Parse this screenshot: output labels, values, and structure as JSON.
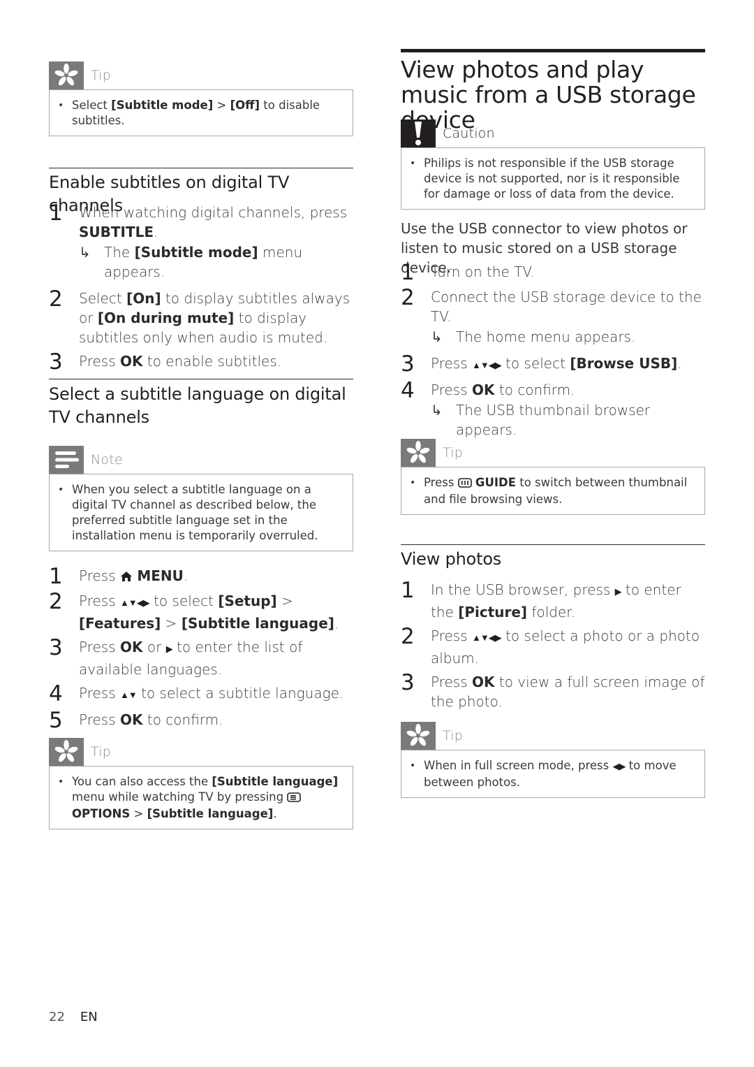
{
  "page": {
    "number": "22",
    "language": "EN"
  },
  "left": {
    "tip1": {
      "title": "Tip",
      "icon": "asterisk-tip-icon",
      "text_pre": "Select ",
      "bold1": "[Subtitle mode]",
      "mid": " > ",
      "bold2": "[Off]",
      "text_post": " to disable subtitles."
    },
    "section_enable": {
      "heading": "Enable subtitles on digital TV channels",
      "steps": [
        {
          "num": "1",
          "pre": "When watching digital channels, press ",
          "bold": "SUBTITLE",
          "post": ".",
          "result_pre": "The ",
          "result_bold": "[Subtitle mode]",
          "result_post": " menu appears."
        },
        {
          "num": "2",
          "pre": "Select ",
          "bold1": "[On]",
          "mid": " to display subtitles always or ",
          "bold2": "[On during mute]",
          "post": " to display subtitles only when audio is muted."
        },
        {
          "num": "3",
          "pre": "Press ",
          "bold": "OK",
          "post": " to enable subtitles."
        }
      ]
    },
    "section_language": {
      "heading": "Select a subtitle language on digital TV channels",
      "note": {
        "title": "Note",
        "icon": "note-lines-icon",
        "text": "When you select a subtitle language on a digital TV channel as described below, the preferred subtitle language set in the installation menu is temporarily overruled."
      },
      "steps": [
        {
          "num": "1",
          "pre": "Press ",
          "icon": "home-icon",
          "bold": "MENU",
          "post": "."
        },
        {
          "num": "2",
          "pre": "Press ",
          "nav": "▲▼◀▶",
          "mid": " to select ",
          "bold1": "[Setup]",
          "sep1": " > ",
          "bold2": "[Features]",
          "sep2": " > ",
          "bold3": "[Subtitle language]",
          "post": "."
        },
        {
          "num": "3",
          "pre": "Press ",
          "bold": "OK",
          "mid": " or ",
          "nav": "▶",
          "post": " to enter the list of available languages."
        },
        {
          "num": "4",
          "pre": "Press ",
          "nav": "▲▼",
          "post": " to select a subtitle language."
        },
        {
          "num": "5",
          "pre": "Press ",
          "bold": "OK",
          "post": " to confirm."
        }
      ],
      "tip": {
        "title": "Tip",
        "icon": "asterisk-tip-icon",
        "pre": "You can also access the ",
        "bold1": "[Subtitle language]",
        "mid": " menu while watching TV by pressing ",
        "options_icon": "options-icon",
        "bold2": "OPTIONS",
        "sep": " > ",
        "bold3": "[Subtitle language]",
        "post": "."
      }
    }
  },
  "right": {
    "title": "View photos and play music from a USB storage device",
    "caution": {
      "title": "Caution",
      "icon": "exclamation-caution-icon",
      "text": "Philips is not responsible if the USB storage device is not supported, nor is it responsible for damage or loss of data from the device."
    },
    "intro": "Use the USB connector to view photos or listen to music stored on a USB storage device.",
    "steps": [
      {
        "num": "1",
        "text": "Turn on the TV."
      },
      {
        "num": "2",
        "text": "Connect the USB storage device to the TV.",
        "result": "The home menu appears."
      },
      {
        "num": "3",
        "pre": "Press ",
        "nav": "▲▼◀▶",
        "mid": " to select ",
        "bold": "[Browse USB]",
        "post": "."
      },
      {
        "num": "4",
        "pre": "Press ",
        "bold": "OK",
        "post": " to confirm.",
        "result": "The USB thumbnail browser appears."
      }
    ],
    "tip1": {
      "title": "Tip",
      "icon": "asterisk-tip-icon",
      "pre": "Press ",
      "guide_icon": "guide-icon",
      "bold": "GUIDE",
      "post": " to switch between thumbnail and file browsing views."
    },
    "view_photos": {
      "heading": "View photos",
      "steps": [
        {
          "num": "1",
          "pre": "In the USB browser, press ",
          "nav": "▶",
          "mid": " to enter the ",
          "bold": "[Picture]",
          "post": " folder."
        },
        {
          "num": "2",
          "pre": "Press ",
          "nav": "▲▼◀▶",
          "post": " to select a photo or a photo album."
        },
        {
          "num": "3",
          "pre": "Press ",
          "bold": "OK",
          "post": " to view a full screen image of the photo."
        }
      ],
      "tip": {
        "title": "Tip",
        "icon": "asterisk-tip-icon",
        "pre": "When in full screen mode, press ",
        "nav": "◀▶",
        "post": " to move between photos."
      }
    }
  }
}
